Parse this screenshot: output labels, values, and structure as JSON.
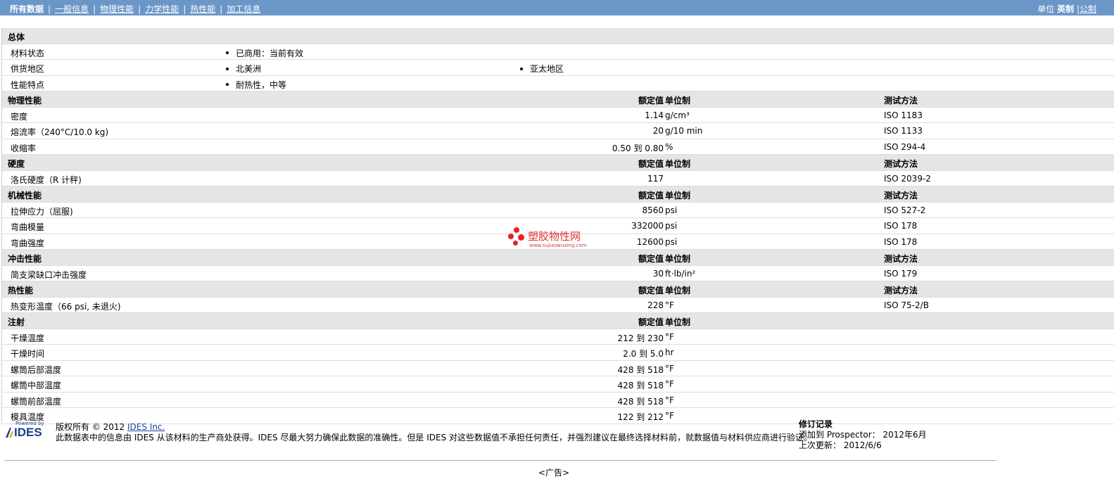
{
  "nav": {
    "items": [
      {
        "label": "所有数据",
        "active": true
      },
      {
        "label": "一般信息"
      },
      {
        "label": "物理性能"
      },
      {
        "label": "力学性能"
      },
      {
        "label": "热性能"
      },
      {
        "label": "加工信息"
      }
    ],
    "sep": "|"
  },
  "units": {
    "label": "单位",
    "english": "英制",
    "sep": "|",
    "metric": "公制"
  },
  "headers": {
    "value": "额定值",
    "unit": "单位制",
    "test": "测试方法"
  },
  "general": {
    "title": "总体",
    "rows": [
      {
        "label": "材料状态",
        "values": [
          "已商用：当前有效"
        ]
      },
      {
        "label": "供货地区",
        "values": [
          "北美洲",
          "亚太地区"
        ]
      },
      {
        "label": "性能特点",
        "values": [
          "耐热性，中等"
        ]
      }
    ]
  },
  "sections": [
    {
      "title": "物理性能",
      "show_test": true,
      "rows": [
        {
          "label": "密度",
          "value": "1.14",
          "unit": "g/cm³",
          "test": "ISO 1183"
        },
        {
          "label": "熔流率（240°C/10.0 kg)",
          "value": "20",
          "unit": "g/10 min",
          "test": "ISO 1133"
        },
        {
          "label": "收缩率",
          "value": "0.50 到  0.80",
          "unit": "%",
          "test": "ISO 294-4"
        }
      ]
    },
    {
      "title": "硬度",
      "show_test": true,
      "rows": [
        {
          "label": "洛氏硬度（R 计秤)",
          "value": "117",
          "unit": "",
          "test": "ISO 2039-2"
        }
      ]
    },
    {
      "title": "机械性能",
      "show_test": true,
      "rows": [
        {
          "label": "拉伸应力（屈服)",
          "value": "8560",
          "unit": "psi",
          "test": "ISO 527-2"
        },
        {
          "label": "弯曲模量",
          "value": "332000",
          "unit": "psi",
          "test": "ISO 178"
        },
        {
          "label": "弯曲强度",
          "value": "12600",
          "unit": "psi",
          "test": "ISO 178"
        }
      ]
    },
    {
      "title": "冲击性能",
      "show_test": true,
      "rows": [
        {
          "label": "简支梁缺口冲击强度",
          "value": "30",
          "unit": "ft·lb/in²",
          "test": "ISO 179"
        }
      ]
    },
    {
      "title": "热性能",
      "show_test": true,
      "rows": [
        {
          "label": "热变形温度（66 psi, 未退火)",
          "value": "228",
          "unit": "°F",
          "test": "ISO 75-2/B"
        }
      ]
    },
    {
      "title": "注射",
      "show_test": false,
      "rows": [
        {
          "label": "干燥温度",
          "value": "212 到  230",
          "unit": "°F",
          "test": ""
        },
        {
          "label": "干燥时间",
          "value": "2.0 到  5.0",
          "unit": "hr",
          "test": ""
        },
        {
          "label": "螺筒后部温度",
          "value": "428 到  518",
          "unit": "°F",
          "test": ""
        },
        {
          "label": "螺筒中部温度",
          "value": "428 到  518",
          "unit": "°F",
          "test": ""
        },
        {
          "label": "螺筒前部温度",
          "value": "428 到  518",
          "unit": "°F",
          "test": ""
        },
        {
          "label": "模具温度",
          "value": "122 到  212",
          "unit": "°F",
          "test": ""
        }
      ]
    }
  ],
  "footer": {
    "logo_small": "Powered by",
    "logo_text": "IDES",
    "copyright": "版权所有  © 2012 ",
    "copyright_link": "IDES Inc.",
    "disclaimer": "此数据表中的信息由  IDES 从该材料的生产商处获得。IDES 尽最大努力确保此数据的准确性。但是  IDES 对这些数据值不承担任何责任，并强烈建议在最终选择材料前，就数据值与材料供应商进行验证。",
    "rev_title": "修订记录",
    "rev_added": "添加到  Prospector：  2012年6月",
    "rev_updated": "上次更新：  2012/6/6"
  },
  "watermark": {
    "text": "塑胶物性网",
    "url": "www.sujiaowuxing.com"
  },
  "ad": "<广告>"
}
